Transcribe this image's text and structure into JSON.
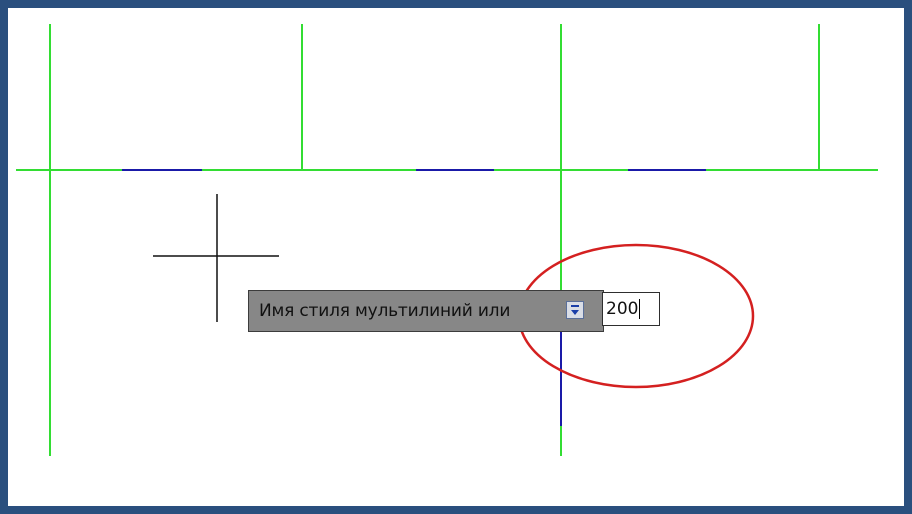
{
  "prompt": {
    "label": "Имя стиля мультилиний или"
  },
  "input": {
    "value": "200"
  },
  "icons": {
    "dropdown": "chevron-down-icon",
    "crosshair": "crosshair-cursor-icon"
  },
  "colors": {
    "frame_border": "#2a4f7e",
    "grid_line": "#33dd33",
    "segment_line": "#1a1aa8",
    "highlight_circle": "#d42020",
    "prompt_background": "#878787",
    "crosshair": "#111111"
  }
}
